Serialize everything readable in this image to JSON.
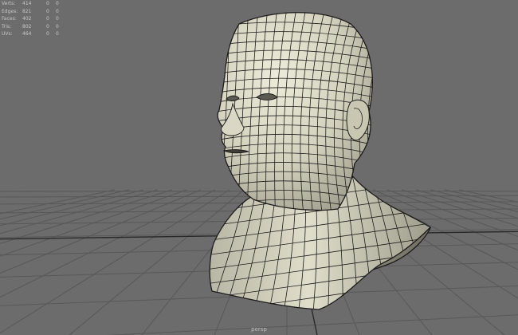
{
  "hud": {
    "rows": [
      {
        "label": "Verts:",
        "value": "414",
        "selected": "0",
        "components": "0"
      },
      {
        "label": "Edges:",
        "value": "821",
        "selected": "0",
        "components": "0"
      },
      {
        "label": "Faces:",
        "value": "402",
        "selected": "0",
        "components": "0"
      },
      {
        "label": "Tris:",
        "value": "802",
        "selected": "0",
        "components": "0"
      },
      {
        "label": "UVs:",
        "value": "464",
        "selected": "0",
        "components": "0"
      }
    ]
  },
  "viewport": {
    "camera": "persp",
    "background_color": "#6c6c6c",
    "grid_color": "#585858",
    "grid_axis_color": "#2a2a2a",
    "mesh_fill_color": "#d6d4bf",
    "mesh_wire_color": "#1c1c1c"
  }
}
